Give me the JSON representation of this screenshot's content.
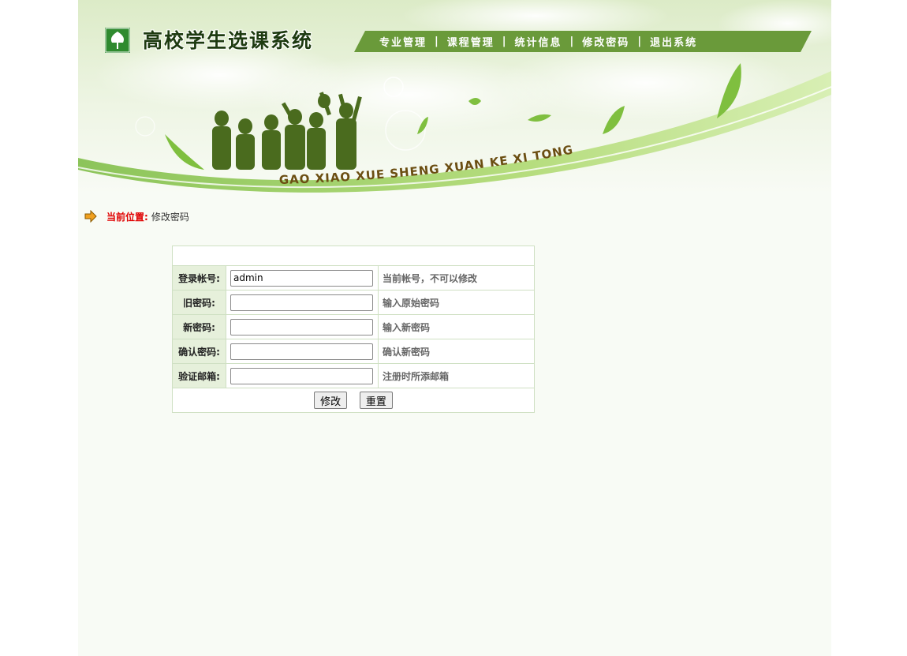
{
  "header": {
    "title": "高校学生选课系统",
    "slogan": "GAO XIAO XUE SHENG XUAN KE XI TONG",
    "nav": [
      {
        "label": "专业管理"
      },
      {
        "label": "课程管理"
      },
      {
        "label": "统计信息"
      },
      {
        "label": "修改密码"
      },
      {
        "label": "退出系统"
      }
    ],
    "nav_separator": "|"
  },
  "breadcrumb": {
    "label": "当前位置:",
    "current": "修改密码"
  },
  "form": {
    "rows": [
      {
        "label": "登录帐号:",
        "value": "admin",
        "hint": "当前帐号，不可以修改"
      },
      {
        "label": "旧密码:",
        "value": "",
        "hint": "输入原始密码"
      },
      {
        "label": "新密码:",
        "value": "",
        "hint": "输入新密码"
      },
      {
        "label": "确认密码:",
        "value": "",
        "hint": "确认新密码"
      },
      {
        "label": "验证邮箱:",
        "value": "",
        "hint": "注册时所添邮箱"
      }
    ],
    "submit_label": "修改",
    "reset_label": "重置"
  },
  "colors": {
    "nav_bar": "#6a9a3a",
    "breadcrumb_label": "#e00000",
    "label_cell": "#e6f0db",
    "border": "#cfe0c3"
  }
}
